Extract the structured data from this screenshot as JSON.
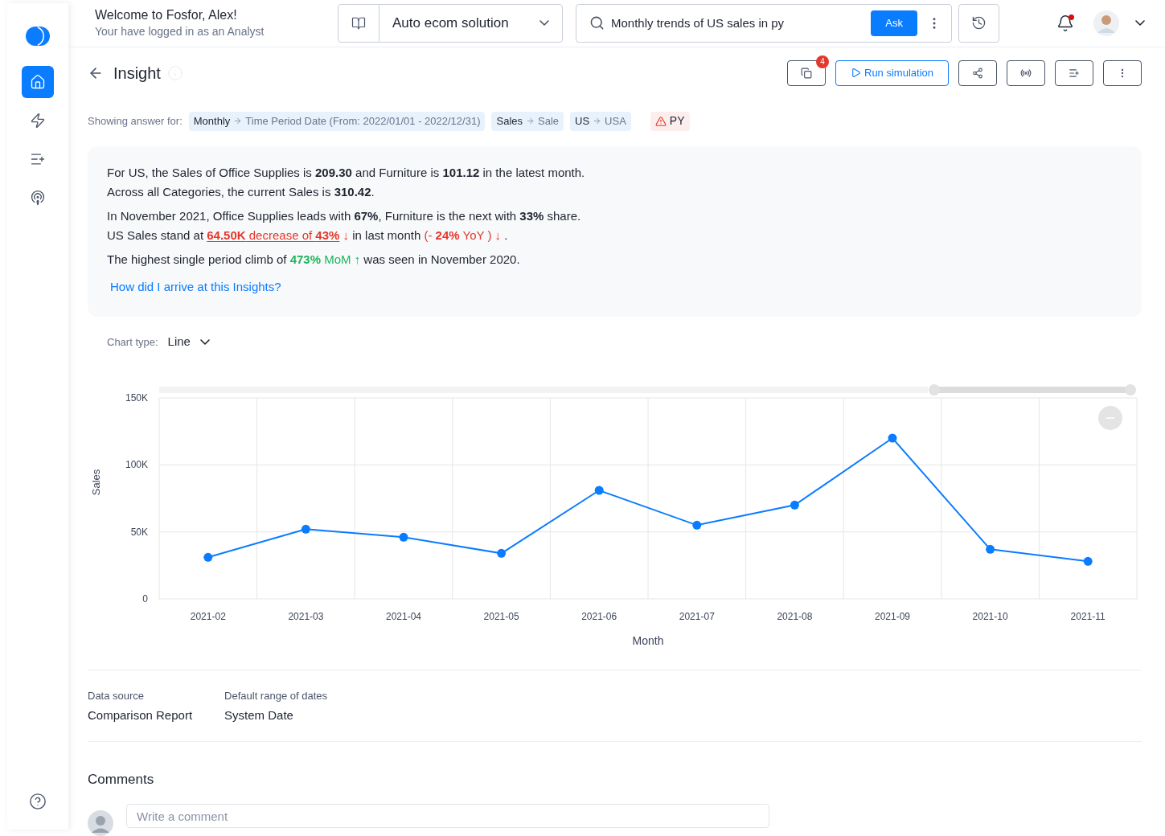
{
  "sidebar": {
    "items": [
      {
        "selected": true
      },
      {
        "selected": false
      },
      {
        "selected": false
      },
      {
        "selected": false
      }
    ]
  },
  "header": {
    "title": "Welcome to Fosfor, Alex!",
    "subtitle": "Your have logged in as an Analyst",
    "dataset": "Auto ecom solution",
    "query": "Monthly trends of US sales in py",
    "ask": "Ask",
    "notification": true
  },
  "page": {
    "title": "Insight",
    "badge": "4",
    "run": "Run simulation"
  },
  "filters": {
    "label": "Showing answer for:",
    "chips": [
      {
        "key": "Monthly",
        "value": "Time Period Date (From: 2022/01/01 - 2022/12/31)"
      },
      {
        "key": "Sales",
        "value": "Sale"
      },
      {
        "key": "US",
        "value": "USA"
      }
    ],
    "warning": "PY"
  },
  "insight": {
    "paragraphs": [
      {
        "lines": [
          [
            {
              "text": "For US, the Sales of Office Supplies is **209.30** and Furniture is **101.12** in the latest month.",
              "kind": "plain"
            }
          ],
          [
            {
              "text": "Across all Categories, the current Sales is **310.42**.",
              "kind": "plain"
            }
          ]
        ]
      },
      {
        "lines": [
          [
            {
              "text": "In November 2021, Office Supplies leads with **67%**, Furniture is the next with **33%** share.",
              "kind": "plain"
            }
          ],
          [
            {
              "text": "US Sales stand at ",
              "kind": "plain"
            },
            {
              "text": "**64.50K** decrease of **43%**",
              "kind": "down",
              "underline": true
            },
            {
              "text": " ↓ ",
              "kind": "down"
            },
            {
              "text": "in last month ",
              "kind": "plain"
            },
            {
              "text": "(- **24%** YoY ) ↓",
              "kind": "down"
            },
            {
              "text": " .",
              "kind": "plain"
            }
          ]
        ]
      },
      {
        "lines": [
          [
            {
              "text": "The highest single period climb of ",
              "kind": "plain"
            },
            {
              "text": "**473%** MoM ↑",
              "kind": "up"
            },
            {
              "text": " was seen in November 2020.",
              "kind": "plain"
            }
          ]
        ]
      }
    ],
    "link": "How did I arrive at this Insights?"
  },
  "chart_type": {
    "label": "Chart type:",
    "value": "Line"
  },
  "chart_data": {
    "type": "line",
    "xlabel": "Month",
    "ylabel": "Sales",
    "categories": [
      "2021-02",
      "2021-03",
      "2021-04",
      "2021-05",
      "2021-06",
      "2021-07",
      "2021-08",
      "2021-09",
      "2021-10",
      "2021-11"
    ],
    "series": [
      {
        "color": "#0a7cff",
        "marker": "circle",
        "values": [
          31000,
          52000,
          46000,
          34000,
          81000,
          55000,
          70000,
          120000,
          37000,
          28000
        ]
      }
    ],
    "ylim": [
      0,
      150000
    ],
    "yticks": [
      {
        "value": 0,
        "label": "0"
      },
      {
        "value": 50000,
        "label": "50K"
      },
      {
        "value": 100000,
        "label": "100K"
      },
      {
        "value": 150000,
        "label": "150K"
      }
    ]
  },
  "details": [
    {
      "label": "Data source",
      "value": "Comparison Report"
    },
    {
      "label": "Default range of dates",
      "value": "System Date"
    }
  ],
  "comments": {
    "title": "Comments",
    "placeholder": "Write a comment"
  }
}
